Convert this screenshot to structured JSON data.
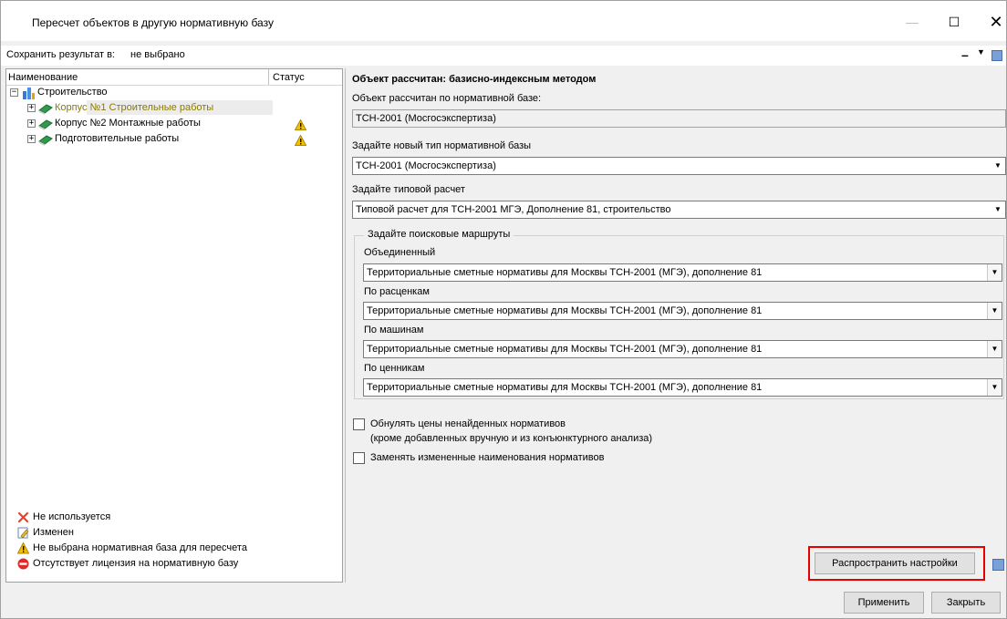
{
  "window": {
    "title": "Пересчет объектов в другую нормативную базу",
    "minimize": "—",
    "maximize": "☐",
    "close": "✕"
  },
  "save": {
    "label": "Сохранить результат в:",
    "value": "не выбрано",
    "minus": "–",
    "dropdown": "▼"
  },
  "tree": {
    "col_name": "Наименование",
    "col_status": "Статус",
    "root": "Строительство",
    "items": [
      {
        "label": "Корпус №1 Строительные работы",
        "status_icon": ""
      },
      {
        "label": "Корпус №2 Монтажные работы",
        "status_icon": "warning-icon"
      },
      {
        "label": "Подготовительные работы",
        "status_icon": "warning-icon"
      }
    ],
    "selected_color": "#8a7a00"
  },
  "legend": [
    {
      "icon": "cross-icon",
      "text": "Не используется"
    },
    {
      "icon": "edit-icon",
      "text": "Изменен"
    },
    {
      "icon": "warning-icon",
      "text": "Не выбрана нормативная база для пересчета"
    },
    {
      "icon": "no-entry-icon",
      "text": "Отсутствует лицензия на нормативную базу"
    }
  ],
  "right": {
    "calc_title": "Объект рассчитан: базисно-индексным методом",
    "calc_base_label": "Объект рассчитан по нормативной базе:",
    "calc_base_value": "ТСН-2001 (Мосгосэкспертиза)",
    "new_base_label": "Задайте новый тип нормативной базы",
    "new_base_value": "ТСН-2001 (Мосгосэкспертиза)",
    "typical_label": "Задайте типовой расчет",
    "typical_value": "Типовой расчет для ТСН-2001 МГЭ, Дополнение 81, строительство",
    "routes_title": "Задайте поисковые маршруты",
    "routes": [
      {
        "label": "Объединенный",
        "value": "Территориальные сметные нормативы для Москвы ТСН-2001 (МГЭ), дополнение 81"
      },
      {
        "label": "По расценкам",
        "value": "Территориальные сметные нормативы для Москвы ТСН-2001 (МГЭ), дополнение 81"
      },
      {
        "label": "По машинам",
        "value": "Территориальные сметные нормативы для Москвы ТСН-2001 (МГЭ), дополнение 81"
      },
      {
        "label": "По ценникам",
        "value": "Территориальные сметные нормативы для Москвы ТСН-2001 (МГЭ), дополнение 81"
      }
    ],
    "chk_zero_line1": "Обнулять цены ненайденных нормативов",
    "chk_zero_line2": "(кроме добавленных вручную и из конъюнктурного анализа)",
    "chk_zero_checked": false,
    "chk_replace": "Заменять измененные наименования нормативов",
    "chk_replace_checked": false,
    "spread_button": "Распространить настройки"
  },
  "footer": {
    "apply": "Применить",
    "close": "Закрыть"
  },
  "colors": {
    "highlight": "#e60000",
    "window_bg": "#f0f0f0"
  }
}
